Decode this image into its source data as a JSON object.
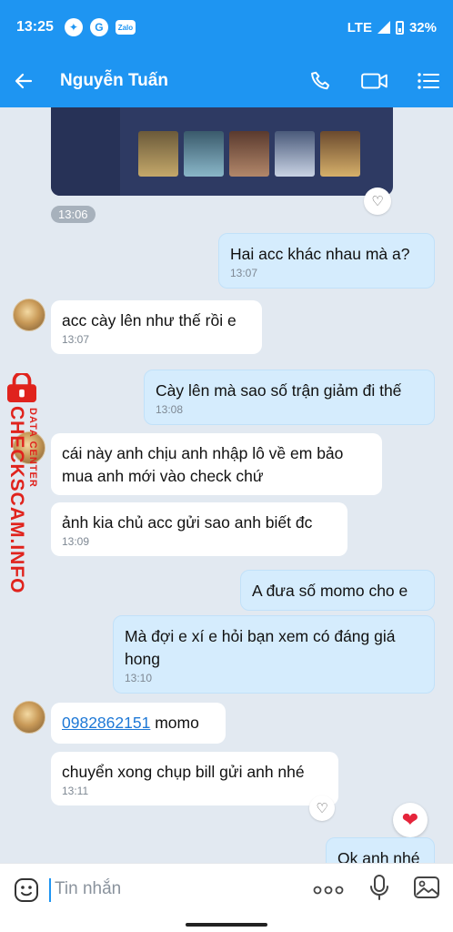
{
  "status_bar": {
    "time": "13:25",
    "network": "LTE",
    "battery": "32%",
    "notif_g": "G",
    "notif_zalo": "Zalo"
  },
  "header": {
    "title": "Nguyễn Tuấn"
  },
  "messages": [
    {
      "time": "13:06"
    },
    {
      "text": "Hai acc khác nhau mà a?",
      "time": "13:07"
    },
    {
      "text": "acc cày lên như thế rồi e",
      "time": "13:07"
    },
    {
      "text": "Cày lên mà sao số trận giảm đi thế",
      "time": "13:08"
    },
    {
      "text": "cái này anh chịu anh nhập lô về em bảo mua anh mới vào check chứ"
    },
    {
      "text": "ảnh kia chủ acc gửi sao anh biết đc",
      "time": "13:09"
    },
    {
      "text": "A đưa số momo cho e"
    },
    {
      "text": "Mà đợi e xí e hỏi bạn xem có đáng giá hong",
      "time": "13:10"
    },
    {
      "phone": "0982862151",
      "text": " momo"
    },
    {
      "text": "chuyển xong chụp bill gửi anh nhé",
      "time": "13:11"
    },
    {
      "text": "Ok anh nhé"
    }
  ],
  "composer": {
    "placeholder": "Tin nhắn"
  },
  "watermark": {
    "brand": "CHECKSCAM.INFO",
    "sub": "DATA CENTER"
  },
  "colors": {
    "accent": "#1e95f2",
    "outgoing_bubble": "#d5ecfd",
    "chat_bg": "#e2e9f1"
  }
}
